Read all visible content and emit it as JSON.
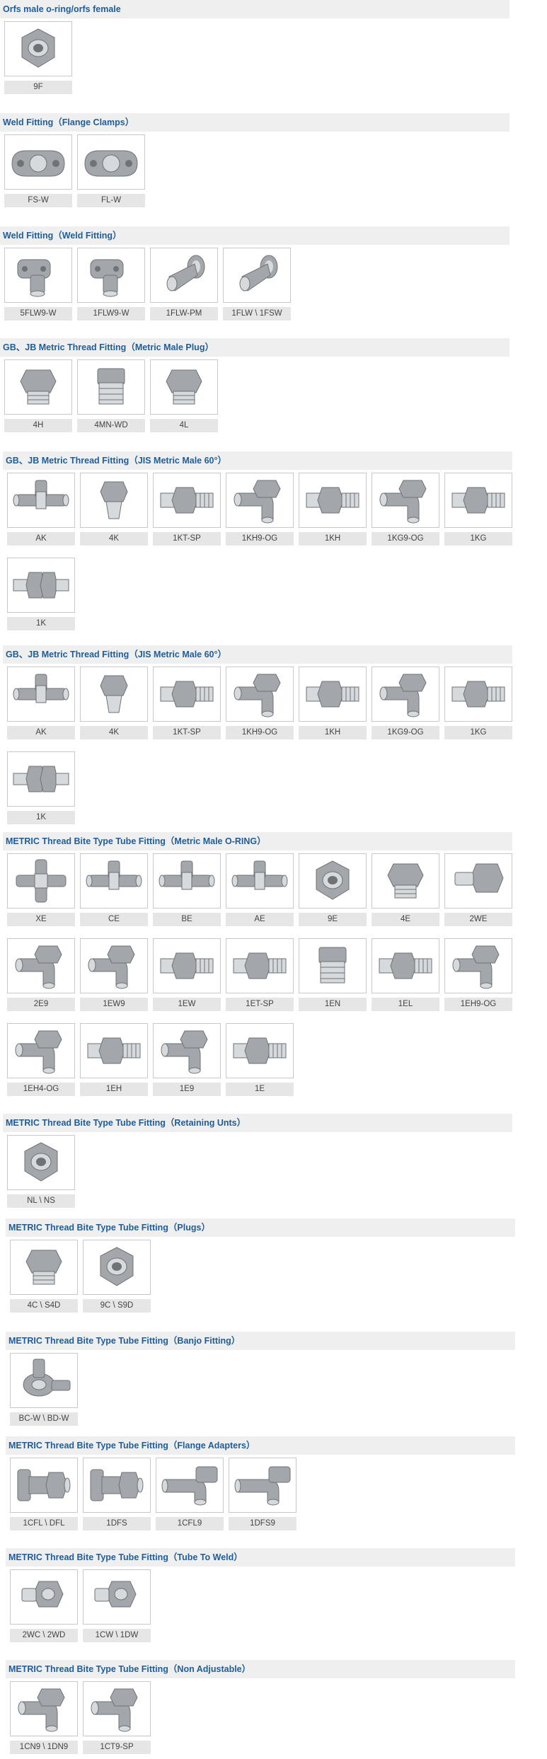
{
  "colors": {
    "heading_text": "#1f5d99",
    "heading_bg": "#efefef",
    "label_bg": "#e6e6e6",
    "thumb_border": "#c8c8c8",
    "part_metal": "#a3a7ab"
  },
  "sections": [
    {
      "title": "Orfs male o-ring/orfs female",
      "items": [
        {
          "label": "9F",
          "icon": "female-nut-fitting-icon"
        }
      ]
    },
    {
      "title": "Weld Fitting（Flange Clamps）",
      "items": [
        {
          "label": "FS-W",
          "icon": "flange-clamp-icon"
        },
        {
          "label": "FL-W",
          "icon": "flange-clamp-icon"
        }
      ]
    },
    {
      "title": "Weld Fitting（Weld Fitting）",
      "items": [
        {
          "label": "5FLW9-W",
          "icon": "weld-elbow-flange-icon"
        },
        {
          "label": "1FLW9-W",
          "icon": "weld-elbow-flange-icon"
        },
        {
          "label": "1FLW-PM",
          "icon": "weld-flange-pipe-icon"
        },
        {
          "label": "1FLW  \\  1FSW",
          "icon": "weld-flange-pipe-icon"
        }
      ]
    },
    {
      "title": "GB、JB Metric Thread Fitting（Metric Male Plug）",
      "items": [
        {
          "label": "4H",
          "icon": "hex-plug-icon"
        },
        {
          "label": "4MN-WD",
          "icon": "threaded-plug-icon"
        },
        {
          "label": "4L",
          "icon": "hex-plug-icon"
        }
      ]
    },
    {
      "title": "GB、JB Metric Thread Fitting（JIS Metric Male 60°）",
      "items": [
        {
          "label": "AK",
          "icon": "tee-fitting-icon"
        },
        {
          "label": "4K",
          "icon": "cone-plug-icon"
        },
        {
          "label": "1KT-SP",
          "icon": "straight-adapter-icon"
        },
        {
          "label": "1KH9-OG",
          "icon": "elbow-fitting-icon"
        },
        {
          "label": "1KH",
          "icon": "straight-adapter-icon"
        },
        {
          "label": "1KG9-OG",
          "icon": "elbow-fitting-icon"
        },
        {
          "label": "1KG",
          "icon": "straight-adapter-icon"
        },
        {
          "label": "1K",
          "icon": "union-fitting-icon"
        }
      ]
    },
    {
      "title": "GB、JB Metric Thread Fitting（JIS Metric Male 60°）",
      "items": [
        {
          "label": "AK",
          "icon": "tee-fitting-icon"
        },
        {
          "label": "4K",
          "icon": "cone-plug-icon"
        },
        {
          "label": "1KT-SP",
          "icon": "straight-adapter-icon"
        },
        {
          "label": "1KH9-OG",
          "icon": "elbow-fitting-icon"
        },
        {
          "label": "1KH",
          "icon": "straight-adapter-icon"
        },
        {
          "label": "1KG9-OG",
          "icon": "elbow-fitting-icon"
        },
        {
          "label": "1KG",
          "icon": "straight-adapter-icon"
        },
        {
          "label": "1K",
          "icon": "union-fitting-icon"
        }
      ]
    },
    {
      "title": "METRIC Thread Bite Type Tube Fitting（Metric Male O-RING）",
      "items": [
        {
          "label": "XE",
          "icon": "cross-fitting-icon"
        },
        {
          "label": "CE",
          "icon": "tee-fitting-icon"
        },
        {
          "label": "BE",
          "icon": "tee-fitting-icon"
        },
        {
          "label": "AE",
          "icon": "tee-fitting-icon"
        },
        {
          "label": "9E",
          "icon": "female-nut-fitting-icon"
        },
        {
          "label": "4E",
          "icon": "hex-plug-icon"
        },
        {
          "label": "2WE",
          "icon": "reducer-fitting-icon"
        },
        {
          "label": "2E9",
          "icon": "elbow-fitting-icon"
        },
        {
          "label": "1EW9",
          "icon": "elbow-fitting-icon"
        },
        {
          "label": "1EW",
          "icon": "straight-adapter-icon"
        },
        {
          "label": "1ET-SP",
          "icon": "straight-adapter-icon"
        },
        {
          "label": "1EN",
          "icon": "threaded-plug-icon"
        },
        {
          "label": "1EL",
          "icon": "straight-adapter-icon"
        },
        {
          "label": "1EH9-OG",
          "icon": "elbow-fitting-icon"
        },
        {
          "label": "1EH4-OG",
          "icon": "elbow-fitting-icon"
        },
        {
          "label": "1EH",
          "icon": "straight-adapter-icon"
        },
        {
          "label": "1E9",
          "icon": "elbow-fitting-icon"
        },
        {
          "label": "1E",
          "icon": "straight-adapter-icon"
        }
      ]
    },
    {
      "title": "METRIC Thread Bite Type Tube Fitting（Retaining Unts）",
      "items": [
        {
          "label": "NL  \\  NS",
          "icon": "female-nut-fitting-icon"
        }
      ]
    },
    {
      "title": "METRIC Thread Bite Type Tube Fitting（Plugs）",
      "items": [
        {
          "label": "4C \\ S4D",
          "icon": "hex-plug-icon"
        },
        {
          "label": "9C \\ S9D",
          "icon": "female-nut-fitting-icon"
        }
      ]
    },
    {
      "title": "METRIC Thread Bite Type Tube Fitting（Banjo Fitting）",
      "items": [
        {
          "label": "BC-W  \\  BD-W",
          "icon": "banjo-fitting-icon"
        }
      ]
    },
    {
      "title": "METRIC Thread Bite Type Tube Fitting（Flange Adapters）",
      "items": [
        {
          "label": "1CFL \\   DFL",
          "icon": "flange-adapter-icon"
        },
        {
          "label": "1DFS",
          "icon": "flange-adapter-icon"
        },
        {
          "label": "1CFL9",
          "icon": "elbow-flange-adapter-icon"
        },
        {
          "label": "1DFS9",
          "icon": "elbow-flange-adapter-icon"
        }
      ]
    },
    {
      "title": "METRIC Thread Bite Type Tube Fitting（Tube To Weld）",
      "items": [
        {
          "label": "2WC \\ 2WD",
          "icon": "weld-nipple-icon"
        },
        {
          "label": "1CW \\ 1DW",
          "icon": "weld-nipple-icon"
        }
      ]
    },
    {
      "title": "METRIC Thread Bite Type Tube Fitting（Non Adjustable）",
      "items": [
        {
          "label": "1CN9 \\ 1DN9",
          "icon": "elbow-fitting-icon"
        },
        {
          "label": "1CT9-SP",
          "icon": "elbow-fitting-icon"
        }
      ]
    }
  ]
}
